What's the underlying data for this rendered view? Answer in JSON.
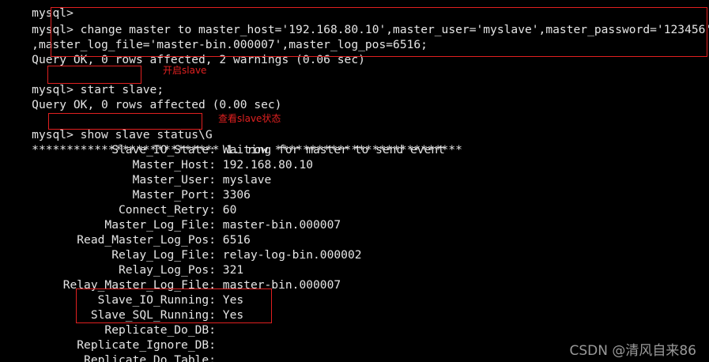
{
  "terminal": {
    "top_partial_prompt": "mysql>",
    "prompt": "mysql>",
    "cmd_change_master_line1": "change master to master_host='192.168.80.10',master_user='myslave',master_password='123456'",
    "cmd_change_master_line2": ",master_log_file='master-bin.000007',master_log_pos=6516;",
    "result_change_master": "Query OK, 0 rows affected, 2 warnings (0.06 sec)",
    "cmd_start_slave": "start slave;",
    "result_start_slave": "Query OK, 0 rows affected (0.00 sec)",
    "cmd_show_status": "show slave status\\G",
    "row_header": "*************************** 1. row ***************************",
    "status_fields": [
      {
        "name": "Slave_IO_State:",
        "value": "Waiting for master to send event"
      },
      {
        "name": "Master_Host:",
        "value": "192.168.80.10"
      },
      {
        "name": "Master_User:",
        "value": "myslave"
      },
      {
        "name": "Master_Port:",
        "value": "3306"
      },
      {
        "name": "Connect_Retry:",
        "value": "60"
      },
      {
        "name": "Master_Log_File:",
        "value": "master-bin.000007"
      },
      {
        "name": "Read_Master_Log_Pos:",
        "value": "6516"
      },
      {
        "name": "Relay_Log_File:",
        "value": "relay-log-bin.000002"
      },
      {
        "name": "Relay_Log_Pos:",
        "value": "321"
      },
      {
        "name": "Relay_Master_Log_File:",
        "value": "master-bin.000007"
      },
      {
        "name": "Slave_IO_Running:",
        "value": "Yes"
      },
      {
        "name": "Slave_SQL_Running:",
        "value": "Yes"
      },
      {
        "name": "Replicate_Do_DB:",
        "value": ""
      },
      {
        "name": "Replicate_Ignore_DB:",
        "value": ""
      },
      {
        "name": "Replicate_Do_Table:",
        "value": ""
      }
    ]
  },
  "annotations": {
    "start_slave_note": "开启slave",
    "show_status_note": "查看slave状态",
    "highlight_color": "#e02020"
  },
  "watermark": "CSDN @清风自来86",
  "colors": {
    "background": "#000000",
    "text": "#e6e6e6"
  }
}
